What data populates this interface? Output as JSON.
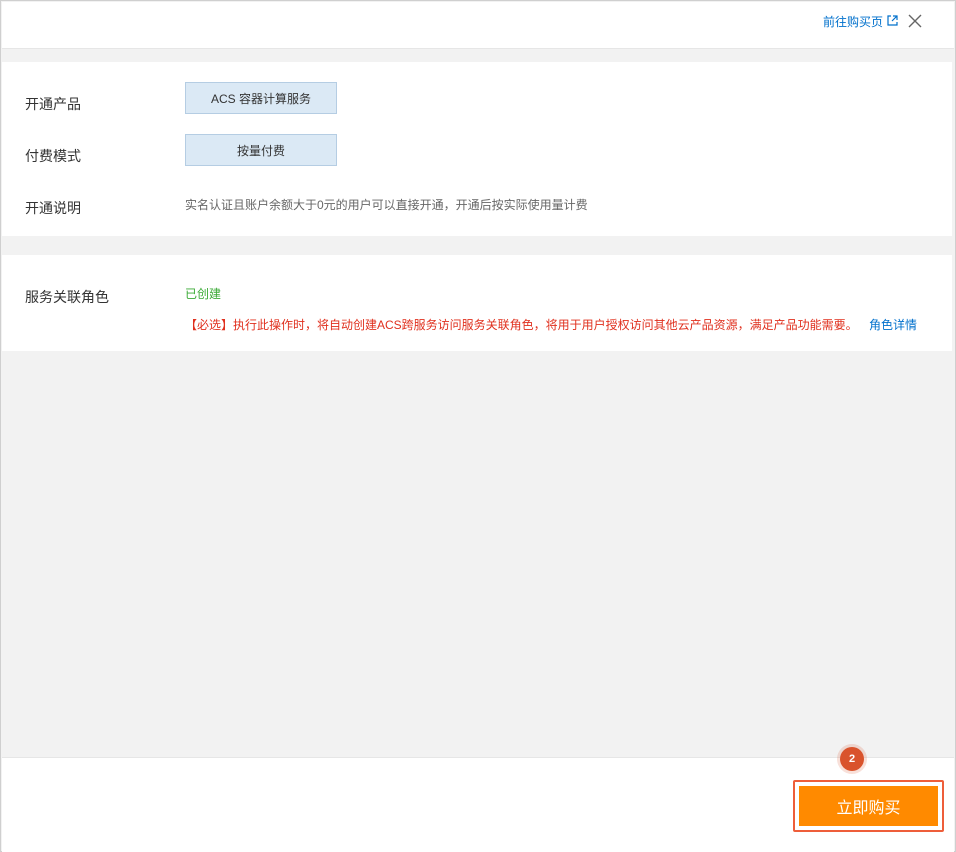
{
  "header": {
    "goto_purchase_link": "前往购买页",
    "external_link_icon": "external-link-icon",
    "close_icon": "close-icon"
  },
  "product_form": {
    "product": {
      "label": "开通产品",
      "value": "ACS 容器计算服务"
    },
    "billing": {
      "label": "付费模式",
      "value": "按量付费"
    },
    "description": {
      "label": "开通说明",
      "value": "实名认证且账户余额大于0元的用户可以直接开通，开通后按实际使用量计费"
    }
  },
  "service_role": {
    "label": "服务关联角色",
    "status": "已创建",
    "required_note": "【必选】执行此操作时，将自动创建ACS跨服务访问服务关联角色，将用于用户授权访问其他云产品资源，满足产品功能需要。",
    "role_details_link": "角色详情"
  },
  "footer": {
    "step_number": "2",
    "buy_button": "立即购买"
  },
  "colors": {
    "link": "#0070cc",
    "success": "#3aaa35",
    "warning": "#e0301e",
    "primary_button": "#ff8a00",
    "highlight": "#ee5e3a"
  }
}
